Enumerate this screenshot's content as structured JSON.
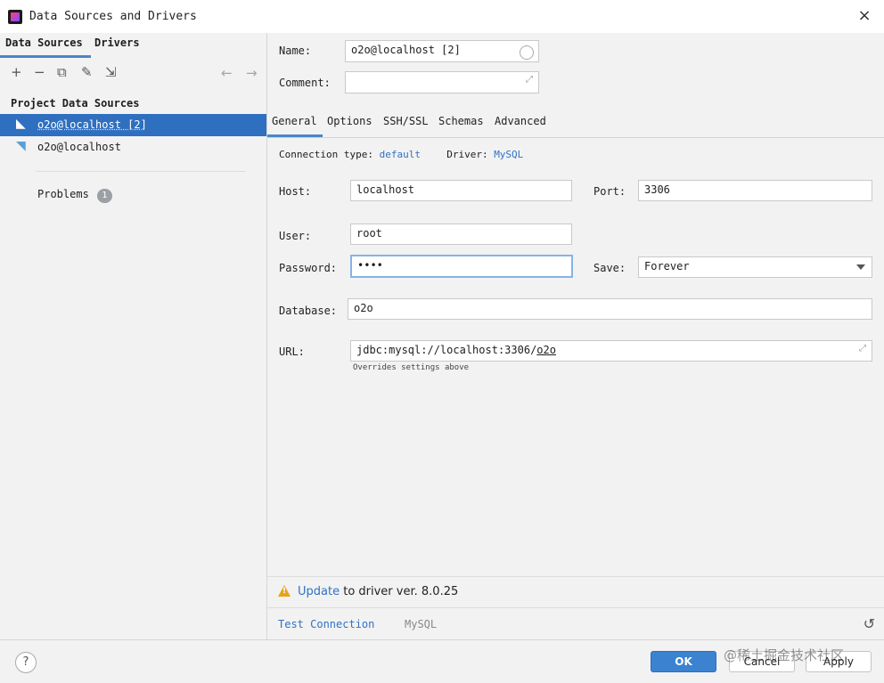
{
  "window": {
    "title": "Data Sources and Drivers",
    "close_glyph": "×"
  },
  "left": {
    "tabs": [
      "Data Sources",
      "Drivers"
    ],
    "toolbar": {
      "add": "+",
      "remove": "−",
      "copy": "⧉",
      "settings": "✎",
      "import": "⇲",
      "back": "←",
      "forward": "→"
    },
    "section_title": "Project Data Sources",
    "items": [
      {
        "label": "o2o@localhost [2]",
        "selected": true
      },
      {
        "label": "o2o@localhost",
        "selected": false
      }
    ],
    "problems": {
      "label": "Problems",
      "count": "1"
    }
  },
  "form": {
    "name_label": "Name:",
    "name_value": "o2o@localhost [2]",
    "comment_label": "Comment:",
    "comment_value": "",
    "tabs": [
      "General",
      "Options",
      "SSH/SSL",
      "Schemas",
      "Advanced"
    ],
    "active_tab": "General",
    "connection_type_label": "Connection type:",
    "connection_type_value": "default",
    "driver_label": "Driver:",
    "driver_value": "MySQL",
    "host_label": "Host:",
    "host_value": "localhost",
    "port_label": "Port:",
    "port_value": "3306",
    "user_label": "User:",
    "user_value": "root",
    "password_label": "Password:",
    "password_value": "••••",
    "save_label": "Save:",
    "save_value": "Forever",
    "database_label": "Database:",
    "database_value": "o2o",
    "url_label": "URL:",
    "url_prefix": "jdbc:mysql://localhost:3306/",
    "url_db": "o2o",
    "url_note": "Overrides settings above"
  },
  "warning": {
    "link": "Update",
    "text": " to driver ver. 8.0.25"
  },
  "footer_bar": {
    "test_connection": "Test Connection",
    "driver_name": "MySQL",
    "reset_glyph": "↺"
  },
  "buttons": {
    "help": "?",
    "ok": "OK",
    "cancel": "Cancel",
    "apply": "Apply"
  },
  "watermark": "@稀土掘金技术社区",
  "colors": {
    "accent": "#2f6fbf",
    "link": "#2f72c4",
    "warning": "#e8a317",
    "ok_button": "#3b82d0"
  }
}
